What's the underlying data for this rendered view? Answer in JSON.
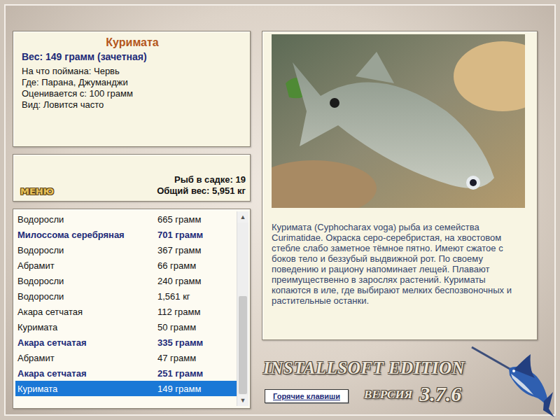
{
  "fish_card": {
    "title": "Куримата",
    "weight": "Вес: 149 грамм (зачетная)",
    "details": [
      "На что поймана: Червь",
      "Где: Парана, Джуманджи",
      "Оценивается с: 100 грамм",
      "Вид: Ловится часто"
    ]
  },
  "menu_button": "МЕНЮ",
  "keepnet": {
    "count": "Рыб в садке: 19",
    "total": "Общий вес: 5,951 кг"
  },
  "catch_list": [
    {
      "name": "Водоросли",
      "weight": "665 грамм",
      "trophy": false,
      "selected": false
    },
    {
      "name": "Милоссома серебряная",
      "weight": "701 грамм",
      "trophy": true,
      "selected": false
    },
    {
      "name": "Водоросли",
      "weight": "367 грамм",
      "trophy": false,
      "selected": false
    },
    {
      "name": "Абрамит",
      "weight": "66 грамм",
      "trophy": false,
      "selected": false
    },
    {
      "name": "Водоросли",
      "weight": "240 грамм",
      "trophy": false,
      "selected": false
    },
    {
      "name": "Водоросли",
      "weight": "1,561 кг",
      "trophy": false,
      "selected": false
    },
    {
      "name": "Акара сетчатая",
      "weight": "112 грамм",
      "trophy": false,
      "selected": false
    },
    {
      "name": "Куримата",
      "weight": "50 грамм",
      "trophy": false,
      "selected": false
    },
    {
      "name": "Акара сетчатая",
      "weight": "335 грамм",
      "trophy": true,
      "selected": false
    },
    {
      "name": "Абрамит",
      "weight": "47 грамм",
      "trophy": false,
      "selected": false
    },
    {
      "name": "Акара сетчатая",
      "weight": "251 грамм",
      "trophy": true,
      "selected": false
    },
    {
      "name": "Куримата",
      "weight": "149 грамм",
      "trophy": false,
      "selected": true
    }
  ],
  "scrollbar": {
    "up": "▲",
    "down": "▼",
    "level": 1
  },
  "description": "Куримата (Cyphocharax voga) рыба из семейства Curimatidae. Окраска серо-серебристая, на хвостовом стебле слабо заметное тёмное пятно. Имеют сжатое с боков тело и беззубый выдвижной рот. По своему поведению и рациону напоминает лещей. Плавают преимущественно в зарослях растений. Куриматы копаются в иле, где выбирают мелких беспозвоночных и растительные останки.",
  "hotkeys_button": "Горячие клавиши",
  "brand": {
    "edition": "INSTALLSOFT EDITION",
    "version_label": "ВЕРСИЯ",
    "version": "3.7.6"
  }
}
